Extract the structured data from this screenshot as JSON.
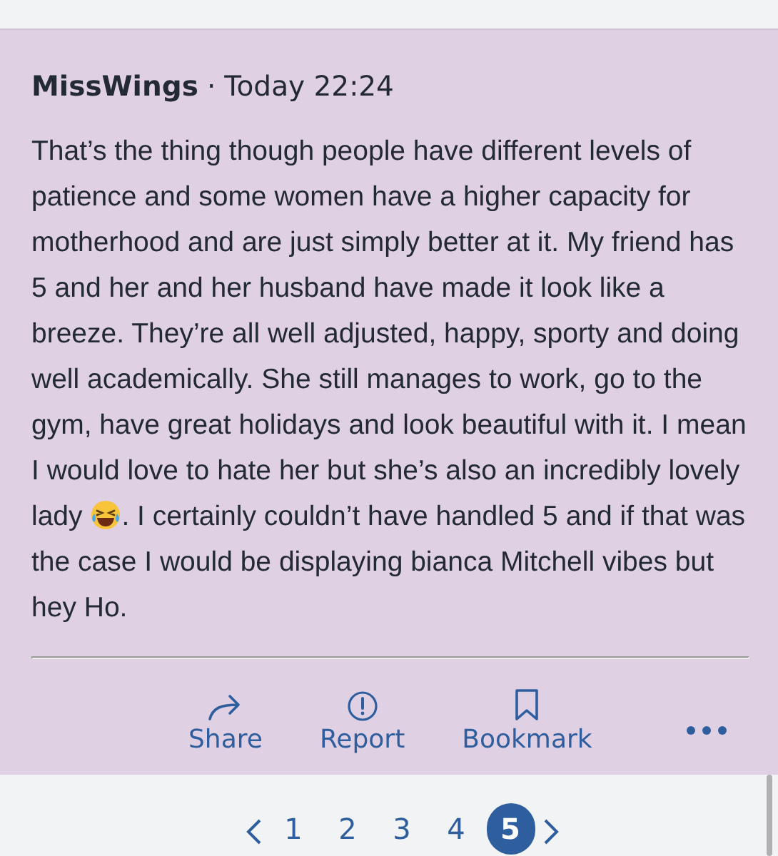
{
  "post": {
    "author": "MissWings",
    "separator": "·",
    "time": "Today 22:24",
    "body": [
      "That’s the thing though people have different levels of patience and some women have a higher capacity for motherhood and are just simply better at it. My friend has 5 and her and her husband have made it look like a breeze. They’re all well adjusted, happy, sporty and doing well academically. She still manages to work, go to the gym, have great holidays and look beautiful with it. I mean I would love to hate her but she’s also an incredibly lovely lady ",
      ". I certainly couldn’t have handled 5 and if that was the case I would be displaying bianca Mitchell vibes but hey Ho."
    ],
    "actions": [
      {
        "kind": "share",
        "label": "Share"
      },
      {
        "kind": "report",
        "label": "Report"
      },
      {
        "kind": "bookmark",
        "label": "Bookmark"
      }
    ]
  },
  "pagination": {
    "pages": [
      {
        "label": "1",
        "selected": false
      },
      {
        "label": "2",
        "selected": false
      },
      {
        "label": "3",
        "selected": false
      },
      {
        "label": "4",
        "selected": false
      },
      {
        "label": "5",
        "selected": true
      }
    ]
  }
}
